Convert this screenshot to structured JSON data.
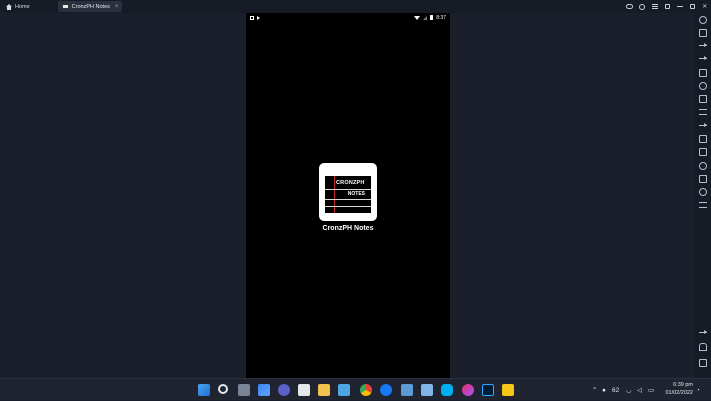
{
  "titlebar": {
    "home_label": "Home",
    "active_tab_label": "CronzPH Notes",
    "close_symbol": "×",
    "controls": [
      "gamepad-icon",
      "account-icon",
      "menu-icon",
      "expand-icon",
      "minimize-icon",
      "restore-icon",
      "close-icon"
    ]
  },
  "phone": {
    "status_left": [
      "notification-square-icon",
      "play-icon"
    ],
    "time": "8:37",
    "status_right": [
      "wifi-icon",
      "signal-icon",
      "battery-icon"
    ],
    "app_name": "CronzPH Notes",
    "logo_text_top": "CRONZPH",
    "logo_text_bottom": "NOTES"
  },
  "right_toolbar": {
    "icons": [
      "settings-icon",
      "keyboard-icon",
      "cursor-icon",
      "volume-icon",
      "screenshot-icon",
      "record-icon",
      "macro-icon",
      "keymap-icon",
      "eco-icon",
      "media-icon",
      "sync-icon",
      "rotate-icon",
      "folder-icon",
      "location-icon",
      "shake-icon",
      "back-icon",
      "home-icon",
      "recent-apps-icon"
    ]
  },
  "taskbar": {
    "apps": [
      "windows-start-icon",
      "search-icon",
      "task-view-icon",
      "widgets-icon",
      "teams-icon",
      "paint-icon",
      "file-explorer-icon",
      "notepad-icon",
      "chrome-icon",
      "facebook-icon",
      "calculator-icon",
      "files-icon",
      "skype-icon",
      "messenger-icon",
      "photoshop-icon",
      "bluestacks-icon"
    ],
    "tray_temp": "62",
    "time": "6:39 pm",
    "date": "01/02/2022"
  },
  "colors": {
    "background": "#1a1f2b",
    "titlebar": "#161b26",
    "phone_bg": "#000000",
    "accent_red": "#c62828"
  }
}
